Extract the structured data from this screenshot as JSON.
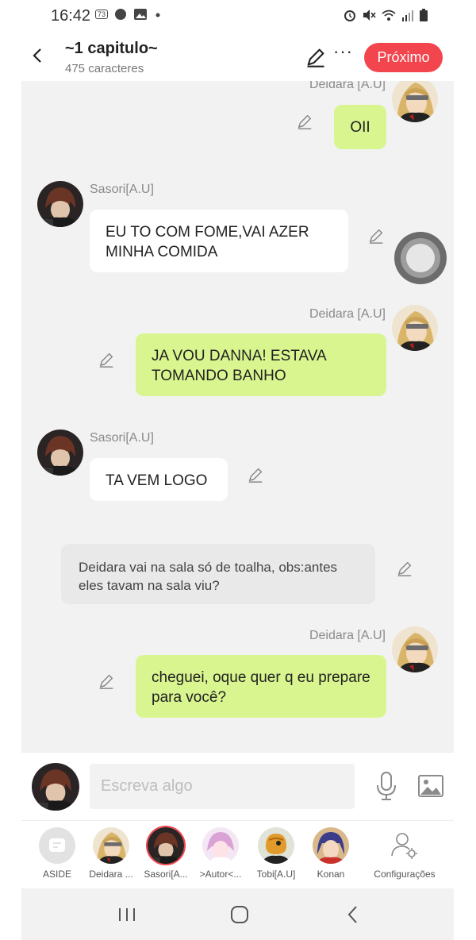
{
  "status_bar": {
    "time": "16:42",
    "notif_badge": "73"
  },
  "header": {
    "title": "~1 capitulo~",
    "subtitle": "475 caracteres",
    "next_label": "Próximo"
  },
  "messages": [
    {
      "type": "sent",
      "sender": "Deidara [A.U]",
      "text": "OII"
    },
    {
      "type": "received",
      "sender": "Sasori[A.U]",
      "text": "EU TO COM FOME,VAI AZER MINHA COMIDA"
    },
    {
      "type": "sent",
      "sender": "Deidara [A.U]",
      "text": "JA VOU DANNA! ESTAVA TOMANDO BANHO"
    },
    {
      "type": "received",
      "sender": "Sasori[A.U]",
      "text": "TA VEM LOGO"
    },
    {
      "type": "narration",
      "text": "Deidara vai na sala só de toalha, obs:antes eles tavam na sala viu?"
    },
    {
      "type": "sent",
      "sender": "Deidara [A.U]",
      "text": "cheguei, oque quer q eu prepare para você?"
    }
  ],
  "input": {
    "placeholder": "Escreva algo"
  },
  "characters": [
    {
      "label": "ASIDE"
    },
    {
      "label": "Deidara ..."
    },
    {
      "label": "Sasori[A..."
    },
    {
      "label": ">Autor<..."
    },
    {
      "label": "Tobi[A.U]"
    },
    {
      "label": "Konan"
    },
    {
      "label": "Configurações"
    }
  ],
  "colors": {
    "accent": "#f2454e",
    "sent_bubble": "#d9f58f",
    "received_bubble": "#ffffff",
    "narration_bubble": "#e9e9e9",
    "chat_bg": "#f2f2f2"
  }
}
